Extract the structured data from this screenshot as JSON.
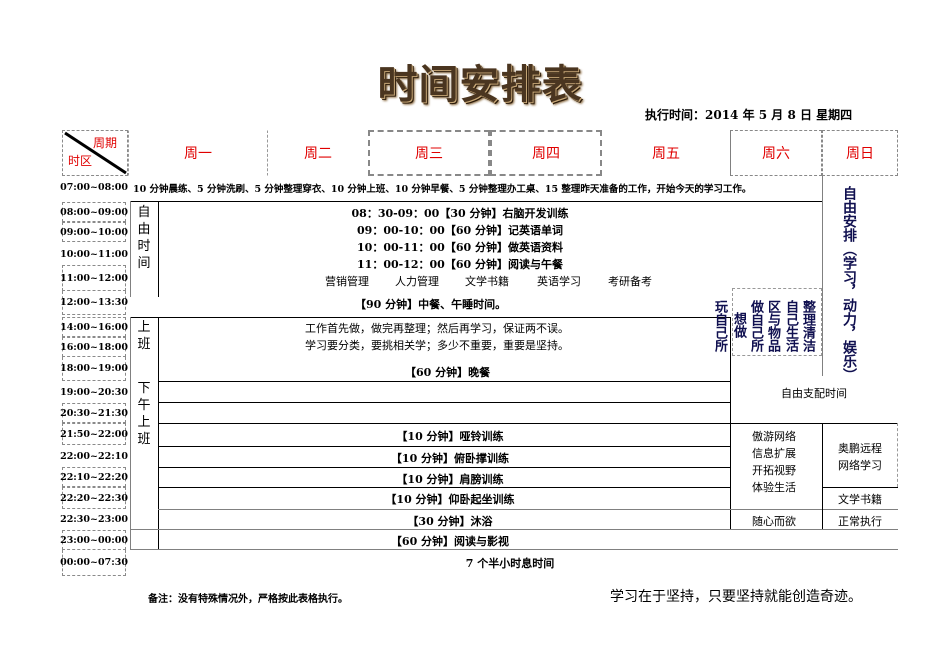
{
  "title": "时间安排表",
  "exec_time": "执行时间：2014 年 5 月 8 日  星期四",
  "header": {
    "corner_top": "周期",
    "corner_bottom": "时区",
    "days": [
      "周一",
      "周二",
      "周三",
      "周四",
      "周五",
      "周六",
      "周日"
    ]
  },
  "times": [
    "07:00~08:00",
    "08:00~09:00",
    "09:00~10:00",
    "10:00~11:00",
    "11:00~12:00",
    "12:00~13:30",
    "14:00~16:00",
    "16:00~18:00",
    "18:00~19:00",
    "19:00~20:30",
    "20:30~21:30",
    "21:50~22:00",
    "22:00~22:10",
    "22:10~22:20",
    "22:20~22:30",
    "22:30~23:00",
    "23:00~00:00",
    "00:00~07:30"
  ],
  "morning_routine": "10 分钟晨练、5 分钟洗刷、5 分钟整理穿衣、10 分钟上班、10 分钟早餐、5 分钟整理办工桌、15 整理昨天准备的工作，开始今天的学习工作。",
  "free_time_label": [
    "自",
    "由",
    "时",
    "间"
  ],
  "free_time_items": [
    "08：30-09：00【30 分钟】右脑开发训练",
    "09：00-10：00【60 分钟】记英语单词",
    "10：00-11：00【60 分钟】做英语资料",
    "11：00-12：00【60 分钟】阅读与午餐"
  ],
  "subjects": [
    "营销管理",
    "人力管理",
    "文学书籍",
    "英语学习",
    "考研备考"
  ],
  "lunch": "【90 分钟】中餐、午睡时间。",
  "work_label": [
    "上",
    "班"
  ],
  "afternoon_label": [
    "下",
    "午",
    "上",
    "班"
  ],
  "work_notes": [
    "工作首先做，做完再整理；然后再学习，保证两不误。",
    "学习要分类，要挑相关学；多少不重要，重要是坚持。"
  ],
  "dinner": "【60 分钟】晚餐",
  "saturday_columns": [
    "玩自己所",
    "想做",
    "做自己所",
    "区与物品",
    "自己生活",
    "整理清洁"
  ],
  "sunday_text": "自由安排（学习，动力，娱乐）",
  "free_dispose": "自由支配时间",
  "exercises": [
    "【10 分钟】哑铃训练",
    "【10 分钟】俯卧撑训练",
    "【10 分钟】肩膀训练",
    "【10 分钟】仰卧起坐训练",
    "【30 分钟】沐浴",
    "【60 分钟】阅读与影视"
  ],
  "sleep": "7 个半小时息时间",
  "weekend_evening": {
    "left": [
      "傲游网络",
      "信息扩展",
      "开拓视野",
      "体验生活"
    ],
    "right_top": [
      "奥鹏远程",
      "网络学习"
    ],
    "right_mid": "文学书籍",
    "left_bottom": "随心而欲",
    "right_bottom": "正常执行"
  },
  "footer": {
    "note": "备注：没有特殊情况外，严格按此表格执行。",
    "motto": "学习在于坚持，只要坚持就能创造奇迹。"
  }
}
